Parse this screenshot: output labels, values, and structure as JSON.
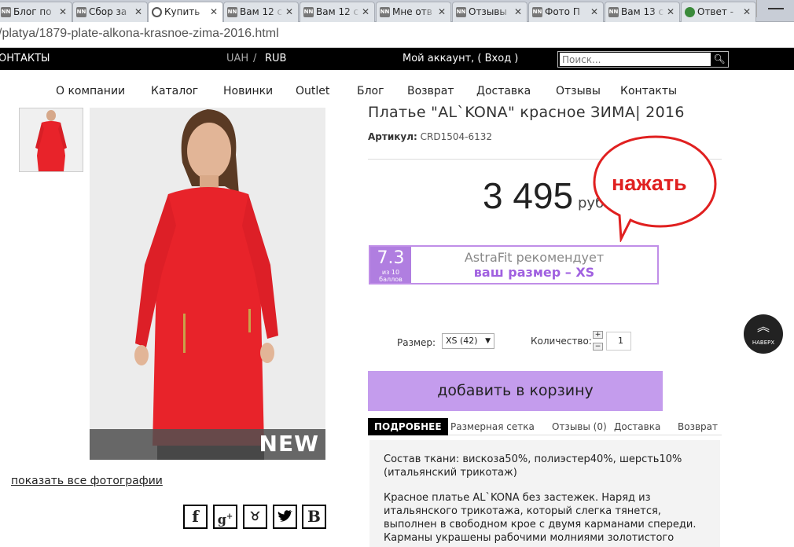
{
  "browser": {
    "tabs": [
      {
        "label": "Блог по",
        "icon": "NN"
      },
      {
        "label": "Сбор за",
        "icon": "NN"
      },
      {
        "label": "Купить",
        "icon": "chrome"
      },
      {
        "label": "Вам 12 с",
        "icon": "NN"
      },
      {
        "label": "Вам 12 с",
        "icon": "NN"
      },
      {
        "label": "Мне отв",
        "icon": "NN"
      },
      {
        "label": "Отзывы",
        "icon": "NN"
      },
      {
        "label": "Фото П",
        "icon": "NN"
      },
      {
        "label": "Вам 13 с",
        "icon": "NN"
      },
      {
        "label": "Ответ -",
        "icon": "green"
      }
    ],
    "url": "/platya/1879-plate-alkona-krasnoe-zima-2016.html"
  },
  "topbar": {
    "contacts": "ОНТАКТЫ",
    "currency1": "UAH",
    "separator": "/",
    "currency2": "RUB",
    "account": "Мой аккаунт, ( Вход )",
    "search_placeholder": "Поиск..."
  },
  "nav": [
    "О компании",
    "Каталог",
    "Новинки",
    "Outlet",
    "Блог",
    "Возврат",
    "Доставка",
    "Отзывы",
    "Контакты"
  ],
  "gallery": {
    "badge": "NEW",
    "show_all": "показать все фотографии"
  },
  "social": [
    "f",
    "g+",
    "ok",
    "tw",
    "В"
  ],
  "product": {
    "title": "Платье \"AL`KONA\" красное ЗИМА|  2016",
    "sku_label": "Артикул:",
    "sku": "CRD1504-6132",
    "price": "3 495",
    "currency": "руб",
    "annotation": "нажать"
  },
  "astrafit": {
    "score": "7.3",
    "score_sub1": "из 10",
    "score_sub2": "баллов",
    "line1": "AstraFit рекомендует",
    "line2": "ваш размер – XS"
  },
  "options": {
    "size_label": "Размер:",
    "size_value": "XS (42)",
    "qty_label": "Количество:",
    "qty_value": "1",
    "plus": "+",
    "minus": "−"
  },
  "cart_button": "добавить в корзину",
  "detail_tabs": [
    "ПОДРОБНЕЕ",
    "Размерная сетка",
    "Отзывы (0)",
    "Доставка",
    "Возврат"
  ],
  "description": {
    "p1": "Состав ткани: вискоза50%, полиэстер40%, шерсть10% (итальянский трикотаж)",
    "p2": "Красное платье AL`KONA без застежек. Наряд из итальянского трикотажа, который слегка тянется, выполнен в свободном крое с двумя карманами спереди. Карманы украшены рабочими молниями золотистого цвета."
  },
  "up_button": "НАВЕРХ",
  "colors": {
    "accent": "#c49ced",
    "astra_score": "#b07ee0",
    "annotation": "#e02020",
    "dress": "#e8232a"
  }
}
